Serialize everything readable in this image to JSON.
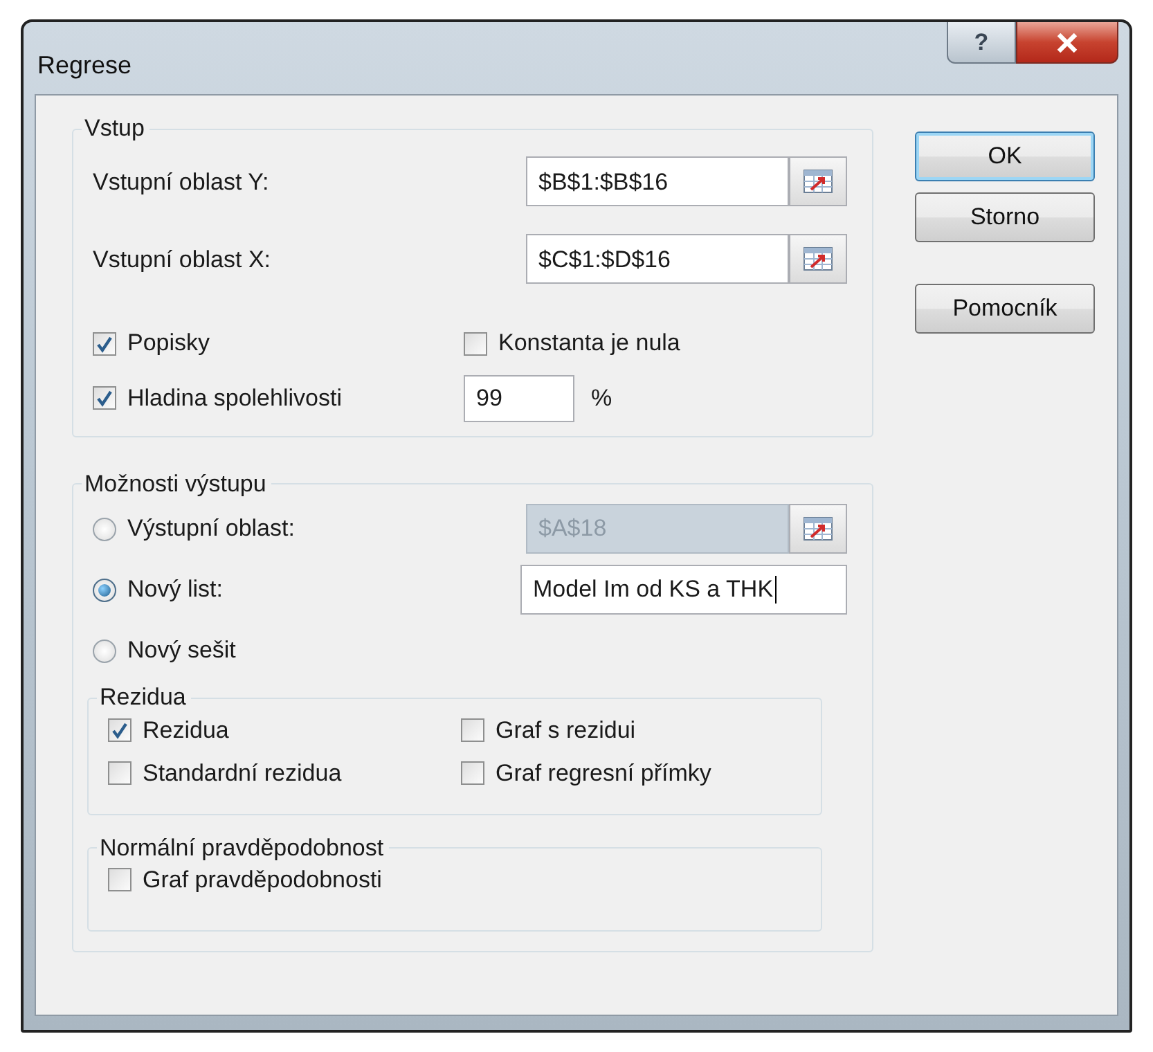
{
  "window": {
    "title": "Regrese",
    "help_button": "?"
  },
  "input": {
    "title": "Vstup",
    "ranges": [
      {
        "label": "Vstupní oblast Y:",
        "value": "$B$1:$B$16"
      },
      {
        "label": "Vstupní oblast X:",
        "value": "$C$1:$D$16"
      }
    ],
    "options": [
      {
        "label": "Popisky",
        "checked": true
      },
      {
        "label": "Konstanta je nula",
        "checked": false
      },
      {
        "label": "Hladina spolehlivosti",
        "checked": true
      }
    ],
    "confidence": {
      "value": "99",
      "unit": "%"
    }
  },
  "output": {
    "title": "Možnosti výstupu",
    "destinations": [
      {
        "label": "Výstupní oblast:",
        "selected": false,
        "kind": "range",
        "value": "$A$18",
        "disabled": true
      },
      {
        "label": "Nový list:",
        "selected": true,
        "kind": "text",
        "value": "Model Im od KS a THK",
        "focused": true
      },
      {
        "label": "Nový sešit",
        "selected": false,
        "kind": "plain"
      }
    ],
    "residuals": {
      "title": "Rezidua",
      "options": [
        {
          "label": "Rezidua",
          "checked": true
        },
        {
          "label": "Graf s rezidui",
          "checked": false
        },
        {
          "label": "Standardní rezidua",
          "checked": false
        },
        {
          "label": "Graf regresní přímky",
          "checked": false
        }
      ]
    },
    "normal": {
      "title": "Normální pravděpodobnost",
      "options": [
        {
          "label": "Graf pravděpodobnosti",
          "checked": false
        }
      ]
    }
  },
  "buttons": [
    {
      "label": "OK",
      "default": true
    },
    {
      "label": "Storno",
      "default": false
    },
    {
      "label": "Pomocník",
      "default": false
    }
  ]
}
